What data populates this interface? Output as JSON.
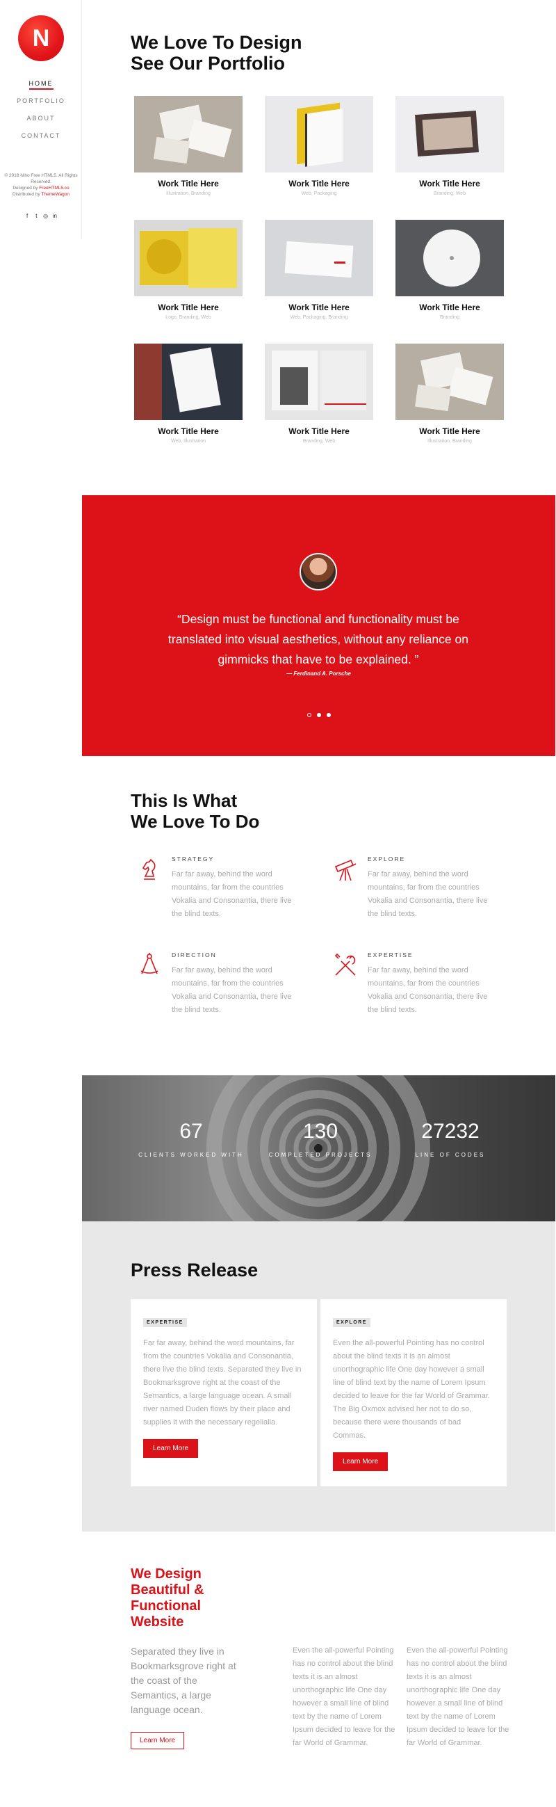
{
  "sidebar": {
    "logo_letter": "N",
    "nav": [
      "Home",
      "Portfolio",
      "About",
      "Contact"
    ],
    "copyright_line1": "© 2018 Niho Free HTML5. All Rights Reserved.",
    "designed_by": "Designed by",
    "designed_by_link": "FreeHTML5.co",
    "distributed_by": "Distributed by",
    "distributed_by_link": "ThemeWagon",
    "social_icons": [
      "facebook-icon",
      "twitter-icon",
      "instagram-icon",
      "linkedin-icon"
    ],
    "social_glyphs": [
      "f",
      "t",
      "◎",
      "in"
    ]
  },
  "portfolio": {
    "title_line1": "We Love To Design",
    "title_line2": "See Our Portfolio",
    "works": [
      {
        "title": "Work Title Here",
        "category": "Illustration, Branding"
      },
      {
        "title": "Work Title Here",
        "category": "Web, Packaging"
      },
      {
        "title": "Work Title Here",
        "category": "Branding, Web"
      },
      {
        "title": "Work Title Here",
        "category": "Logo, Branding, Web"
      },
      {
        "title": "Work Title Here",
        "category": "Web, Packaging, Branding"
      },
      {
        "title": "Work Title Here",
        "category": "Branding"
      },
      {
        "title": "Work Title Here",
        "category": "Web, Illustration"
      },
      {
        "title": "Work Title Here",
        "category": "Branding, Web"
      },
      {
        "title": "Work Title Here",
        "category": "Illustration, Branding"
      }
    ]
  },
  "testimonial": {
    "quote": "“Design must be functional and functionality must be translated into visual aesthetics, without any reliance on gimmicks that have to be explained. ”",
    "author": "— Ferdinand A. Porsche"
  },
  "services": {
    "title_line1": "This Is What",
    "title_line2": "We Love To Do",
    "items": [
      {
        "heading": "Strategy",
        "icon": "chess-knight-icon",
        "text": "Far far away, behind the word mountains, far from the countries Vokalia and Consonantia, there live the blind texts."
      },
      {
        "heading": "Explore",
        "icon": "telescope-icon",
        "text": "Far far away, behind the word mountains, far from the countries Vokalia and Consonantia, there live the blind texts."
      },
      {
        "heading": "Direction",
        "icon": "compass-icon",
        "text": "Far far away, behind the word mountains, far from the countries Vokalia and Consonantia, there live the blind texts."
      },
      {
        "heading": "Expertise",
        "icon": "tools-icon",
        "text": "Far far away, behind the word mountains, far from the countries Vokalia and Consonantia, there live the blind texts."
      }
    ]
  },
  "counters": [
    {
      "value": "67",
      "label": "Clients Worked With"
    },
    {
      "value": "130",
      "label": "Completed Projects"
    },
    {
      "value": "27232",
      "label": "Line of Codes"
    }
  ],
  "press": {
    "title": "Press Release",
    "cards": [
      {
        "badge": "Expertise",
        "text": "Far far away, behind the word mountains, far from the countries Vokalia and Consonantia, there live the blind texts. Separated they live in Bookmarksgrove right at the coast of the Semantics, a large language ocean. A small river named Duden flows by their place and supplies it with the necessary regelialia.",
        "button": "Learn More"
      },
      {
        "badge": "Explore",
        "text": "Even the all-powerful Pointing has no control about the blind texts it is an almost unorthographic life One day however a small line of blind text by the name of Lorem Ipsum decided to leave for the far World of Grammar. The Big Oxmox advised her not to do so, because there were thousands of bad Commas.",
        "button": "Learn More"
      }
    ]
  },
  "bottom": {
    "title": "We Design Beautiful & Functional Website",
    "lead": "Separated they live in Bookmarksgrove right at the coast of the Semantics, a large language ocean.",
    "button": "Learn More",
    "col1": "Even the all-powerful Pointing has no control about the blind texts it is an almost unorthographic life One day however a small line of blind text by the name of Lorem Ipsum decided to leave for the far World of Grammar.",
    "col2": "Even the all-powerful Pointing has no control about the blind texts it is an almost unorthographic life One day however a small line of blind text by the name of Lorem Ipsum decided to leave for the far World of Grammar."
  },
  "colors": {
    "accent": "#dc1218",
    "muted_text": "#aaaaaa",
    "press_bg": "#e8e8e8"
  }
}
